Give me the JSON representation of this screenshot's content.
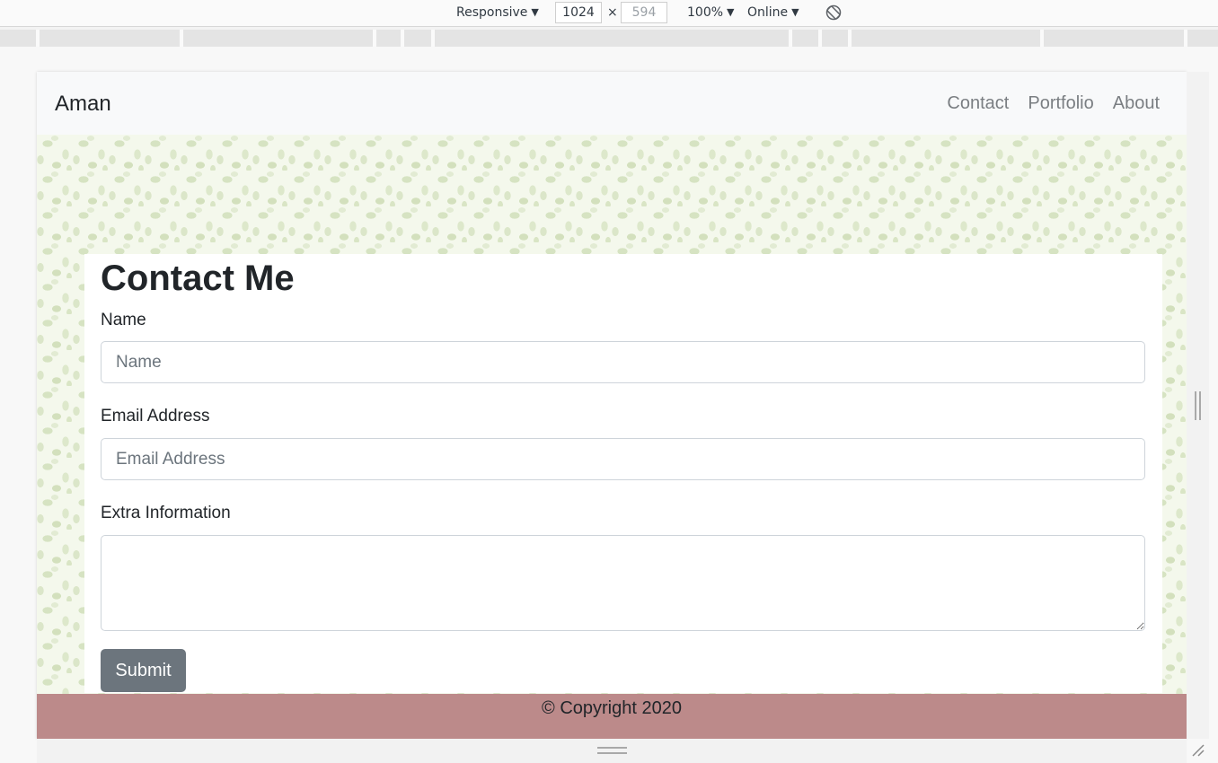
{
  "devtools": {
    "device_mode": "Responsive",
    "width_value": "1024",
    "height_value": "594",
    "dimension_separator": "×",
    "zoom": "100%",
    "throttling": "Online",
    "caret": "▼"
  },
  "navbar": {
    "brand": "Aman",
    "links": [
      {
        "label": "Contact"
      },
      {
        "label": "Portfolio"
      },
      {
        "label": "About"
      }
    ]
  },
  "contact_form": {
    "title": "Contact Me",
    "name_label": "Name",
    "name_placeholder": "Name",
    "email_label": "Email Address",
    "email_placeholder": "Email Address",
    "extra_label": "Extra Information",
    "extra_value": "",
    "submit_label": "Submit"
  },
  "footer": {
    "copyright": "© Copyright 2020"
  },
  "colors": {
    "navbar_bg": "#f8f9fa",
    "footer_bg": "#bc8a8a",
    "submit_bg": "#6c757d",
    "pattern_leaf": "#d6e3c2"
  }
}
